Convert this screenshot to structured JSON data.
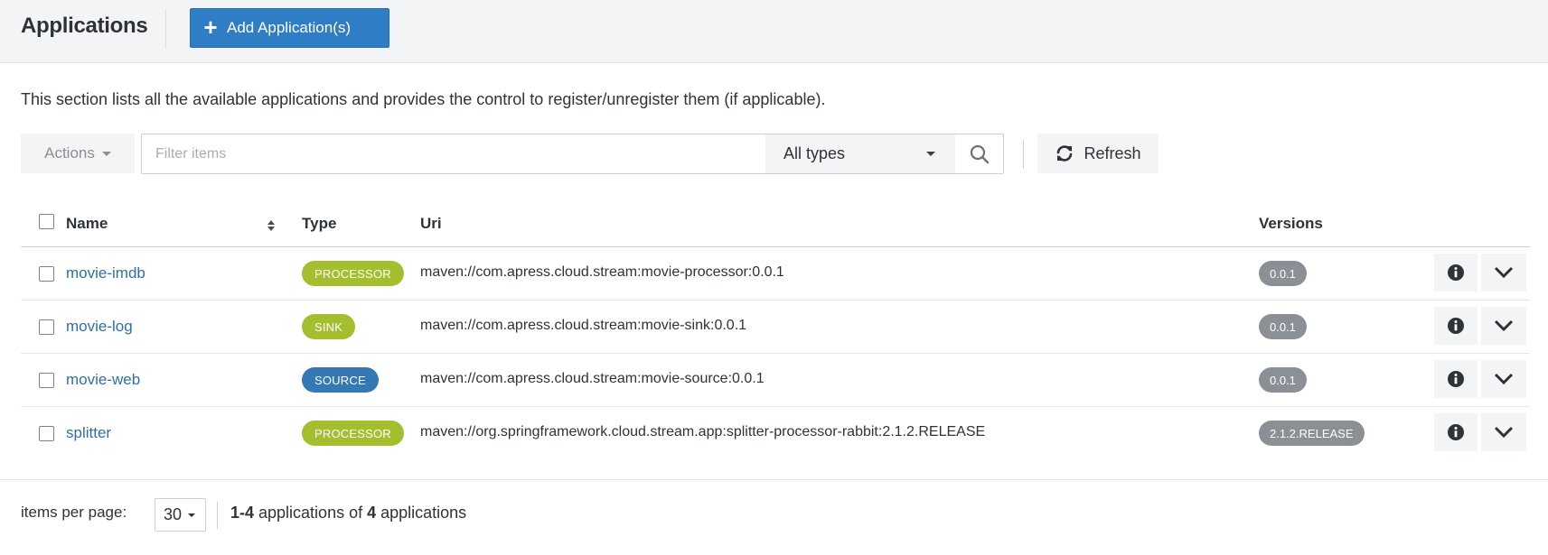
{
  "header": {
    "title": "Applications",
    "add_button": {
      "label": "Add Application(s)",
      "icon": "plus-icon"
    }
  },
  "description": "This section lists all the available applications and provides the control to register/unregister them (if applicable).",
  "toolbar": {
    "actions_label": "Actions",
    "filter_placeholder": "Filter items",
    "type_filter": {
      "selected": "All types"
    },
    "search_icon": "search-icon",
    "refresh_label": "Refresh"
  },
  "table": {
    "columns": {
      "name": "Name",
      "type": "Type",
      "uri": "Uri",
      "versions": "Versions"
    },
    "rows": [
      {
        "name": "movie-imdb",
        "type": "PROCESSOR",
        "uri": "maven://com.apress.cloud.stream:movie-processor:0.0.1",
        "version": "0.0.1"
      },
      {
        "name": "movie-log",
        "type": "SINK",
        "uri": "maven://com.apress.cloud.stream:movie-sink:0.0.1",
        "version": "0.0.1"
      },
      {
        "name": "movie-web",
        "type": "SOURCE",
        "uri": "maven://com.apress.cloud.stream:movie-source:0.0.1",
        "version": "0.0.1"
      },
      {
        "name": "splitter",
        "type": "PROCESSOR",
        "uri": "maven://org.springframework.cloud.stream.app:splitter-processor-rabbit:2.1.2.RELEASE",
        "version": "2.1.2.RELEASE"
      }
    ]
  },
  "type_colors": {
    "PROCESSOR": "#a3bf2d",
    "SINK": "#a3bf2d",
    "SOURCE": "#3579b4"
  },
  "colors": {
    "primary": "#2f7dc4",
    "link": "#2f6fa7",
    "version_badge": "#8a9096"
  },
  "footer": {
    "items_per_page_label": "items per page:",
    "items_per_page_value": "30",
    "range": "1-4",
    "range_text_mid": " applications of ",
    "total": "4",
    "range_text_end": " applications"
  }
}
